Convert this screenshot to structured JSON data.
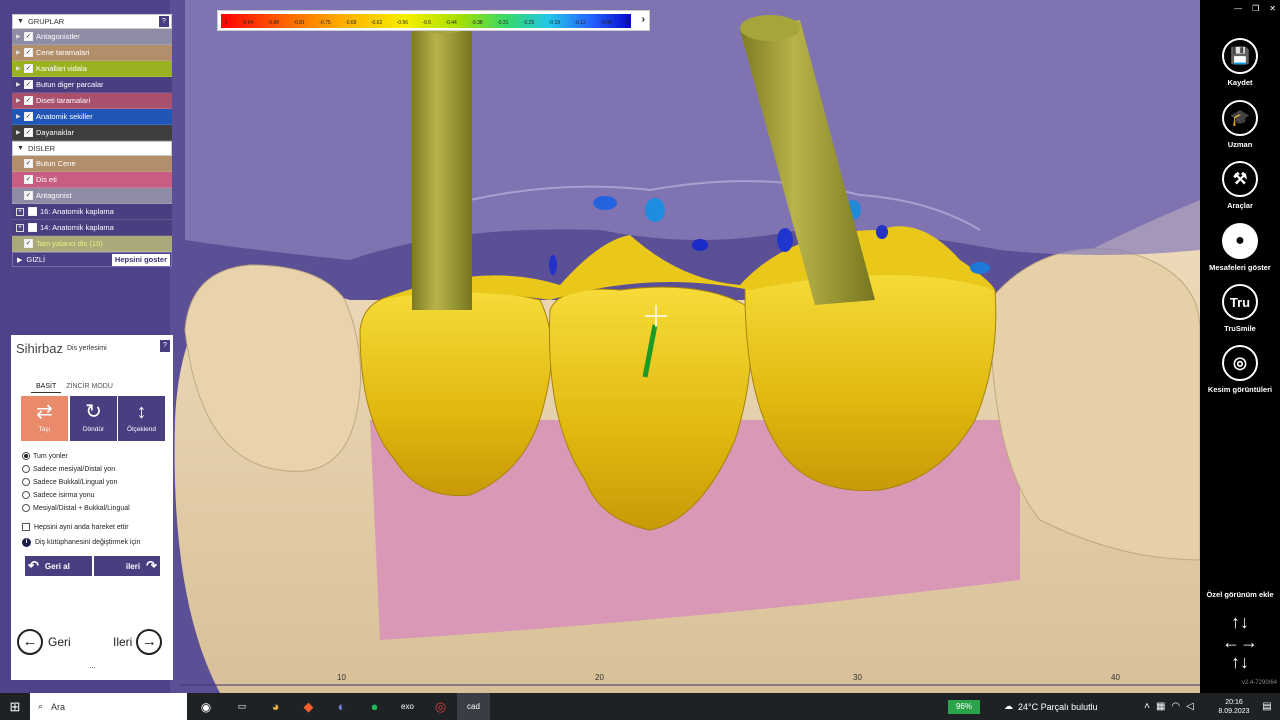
{
  "colorbar": {
    "ticks": [
      "-1",
      "-0.94",
      "-0.88",
      "-0.81",
      "-0.75",
      "-0.69",
      "-0.62",
      "-0.56",
      "-0.5",
      "-0.44",
      "-0.38",
      "-0.31",
      "-0.25",
      "-0.19",
      "-0.12",
      "-0.06",
      "0"
    ],
    "arrow": "›"
  },
  "groups": {
    "header1": "GRUPLAR",
    "help": "?",
    "items": [
      {
        "label": "Antagonistler",
        "color": "#8f8ca6"
      },
      {
        "label": "Cene taramalari",
        "color": "#b38e6a"
      },
      {
        "label": "Kanallari vidala",
        "color": "#9ab220"
      },
      {
        "label": "Butun diger parcalar",
        "color": "#4a3d80"
      },
      {
        "label": "Diseti taramalari",
        "color": "#a8506c"
      },
      {
        "label": "Anatomik sekiller",
        "color": "#1f56b8"
      },
      {
        "label": "Dayanaklar",
        "color": "#3e3e3e"
      }
    ],
    "header2": "DİSLER",
    "teeth": [
      {
        "label": "Butun Cene",
        "color": "#b38e6a"
      },
      {
        "label": "Dis eti",
        "color": "#c75d82"
      },
      {
        "label": "Antagonist",
        "color": "#8f8ca6"
      },
      {
        "label": "16: Anatomik kaplama",
        "color": "#4a3d80"
      },
      {
        "label": "14: Anatomik kaplama",
        "color": "#4a3d80"
      },
      {
        "label": "Tam yalanci dis (15)",
        "color": "#a9a97a"
      }
    ],
    "gizli": "GİZLİ",
    "show_all": "Hepsini goster"
  },
  "wizard": {
    "title": "Sihirbaz",
    "subtitle": "Dis yerlesimi",
    "help": "?",
    "tab_basic": "BASİT",
    "tab_chain": "ZİNCİR MODU",
    "btn_move": "Taşı",
    "btn_rotate": "Döndür",
    "btn_scale": "Ölçeklend",
    "radios": [
      "Tum yonler",
      "Sadece mesiyal/Distal yon",
      "Sadece Bukkal/Lingual yon",
      "Sadece isirma yonu",
      "Mesiyal/Distal + Bukkal/Lingual"
    ],
    "check_all": "Hepsini ayni anda hareket ettir",
    "library": "Diş kütüphanesini değiştirmek için",
    "undo": "Geri al",
    "redo": "ileri",
    "back": "Geri",
    "next": "Ileri",
    "dots": "..."
  },
  "ruler": [
    "10",
    "20",
    "30",
    "40"
  ],
  "rbar": {
    "save": "Kaydet",
    "expert": "Uzman",
    "tools": "Araçlar",
    "distances": "Mesafeleri göster",
    "trusmile": "TruSmile",
    "trusmile_icon": "Tru",
    "cuts": "Kesim görüntüleri",
    "custom_view": "Özel görünüm ekle",
    "version": "v2.4-7290/64"
  },
  "taskbar": {
    "search": "Ara",
    "battery": "96%",
    "weather": "24°C  Parçalı bulutlu",
    "time": "20:16",
    "date": "8.09.2023",
    "app_exo": "exo",
    "app_cad": "cad"
  }
}
